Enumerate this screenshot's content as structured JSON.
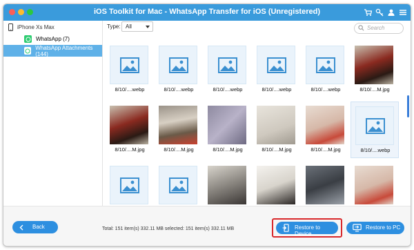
{
  "window": {
    "title": "iOS Toolkit for Mac - WhatsApp Transfer for iOS (Unregistered)",
    "accent_color": "#3a9bdc",
    "titlebar_icons": [
      "cart-icon",
      "key-icon",
      "user-icon",
      "menu-icon"
    ]
  },
  "sidebar": {
    "device": "iPhone Xs Max",
    "items": [
      {
        "label": "WhatsApp (7)",
        "icon": "whatsapp-icon",
        "active": false
      },
      {
        "label": "WhatsApp Attachments (144)",
        "icon": "whatsapp-icon",
        "active": true
      }
    ]
  },
  "filter": {
    "type_label": "Type:",
    "type_value": "All",
    "search_placeholder": "Search"
  },
  "grid": {
    "items": [
      {
        "caption": "8/10/....webp",
        "kind": "placeholder"
      },
      {
        "caption": "8/10/....webp",
        "kind": "placeholder"
      },
      {
        "caption": "8/10/....webp",
        "kind": "placeholder"
      },
      {
        "caption": "8/10/....webp",
        "kind": "placeholder"
      },
      {
        "caption": "8/10/....webp",
        "kind": "placeholder"
      },
      {
        "caption": "8/10/....M.jpg",
        "kind": "photo-cola-bottle"
      },
      {
        "caption": "8/10/....M.jpg",
        "kind": "photo-cola-bottle"
      },
      {
        "caption": "8/10/....M.jpg",
        "kind": "photo-cat-figurine"
      },
      {
        "caption": "8/10/....M.jpg",
        "kind": "photo-blurry"
      },
      {
        "caption": "8/10/....M.jpg",
        "kind": "photo-paper"
      },
      {
        "caption": "8/10/....M.jpg",
        "kind": "photo-sticker"
      },
      {
        "caption": "8/10/....webp",
        "kind": "placeholder",
        "selected": true
      },
      {
        "caption": "",
        "kind": "placeholder"
      },
      {
        "caption": "",
        "kind": "placeholder"
      },
      {
        "caption": "",
        "kind": "photo-cats"
      },
      {
        "caption": "",
        "kind": "photo-family-theater"
      },
      {
        "caption": "",
        "kind": "photo-headphones"
      },
      {
        "caption": "",
        "kind": "photo-sticker"
      }
    ]
  },
  "footer": {
    "back_label": "Back",
    "status_text": "Total: 151 item(s) 332.11 MB    selected: 151 item(s) 332.11 MB",
    "restore_device_label": "Restore to Device",
    "restore_pc_label": "Restore to PC",
    "highlight_color": "#d8282b"
  }
}
